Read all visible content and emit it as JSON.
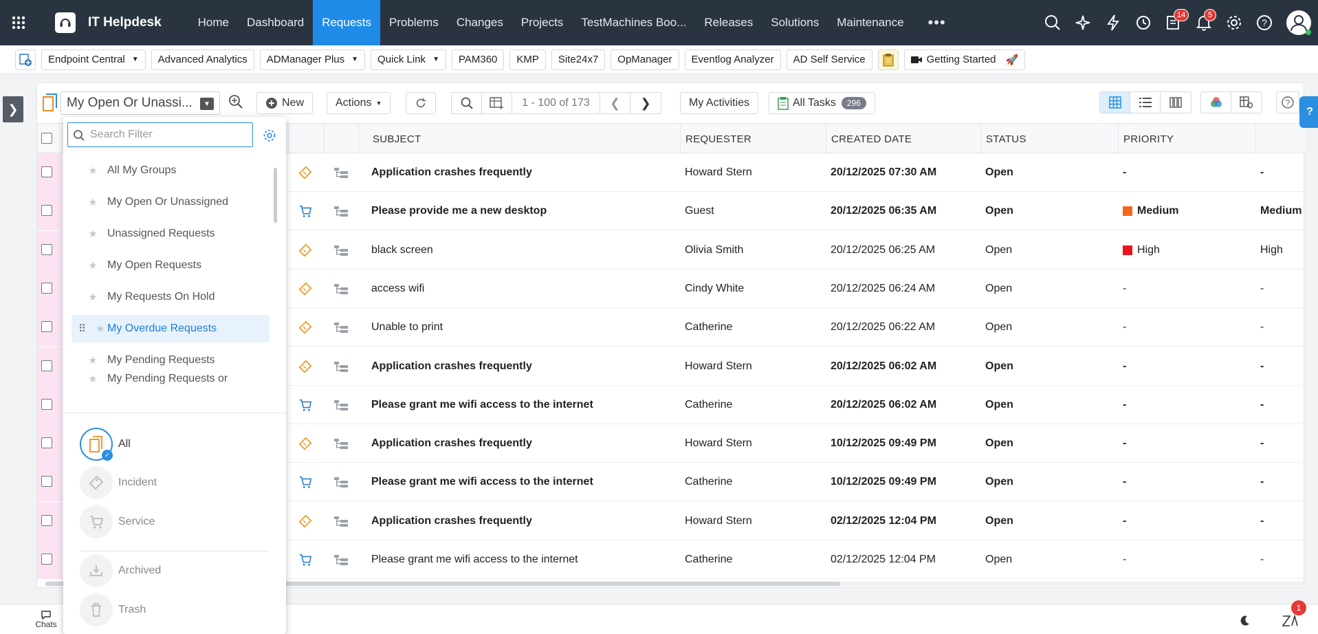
{
  "app": {
    "name": "IT Helpdesk"
  },
  "nav": {
    "tabs": [
      "Home",
      "Dashboard",
      "Requests",
      "Problems",
      "Changes",
      "Projects",
      "TestMachines Boo...",
      "Releases",
      "Solutions",
      "Maintenance"
    ],
    "active": "Requests",
    "more": "•••",
    "badges": {
      "tasks": "14",
      "notifications": "5"
    }
  },
  "quicklinks": {
    "items": [
      {
        "label": "Endpoint Central",
        "dropdown": true
      },
      {
        "label": "Advanced Analytics",
        "dropdown": false
      },
      {
        "label": "ADManager Plus",
        "dropdown": true
      },
      {
        "label": "Quick Link",
        "dropdown": true
      },
      {
        "label": "PAM360",
        "dropdown": false
      },
      {
        "label": "KMP",
        "dropdown": false
      },
      {
        "label": "Site24x7",
        "dropdown": false
      },
      {
        "label": "OpManager",
        "dropdown": false
      },
      {
        "label": "Eventlog Analyzer",
        "dropdown": false
      },
      {
        "label": "AD Self Service",
        "dropdown": false
      }
    ],
    "getting_started": "Getting Started"
  },
  "toolbar": {
    "view": "My Open Or Unassi...",
    "new": "New",
    "actions": "Actions",
    "paging": "1 - 100 of 173",
    "my_activities": "My Activities",
    "all_tasks": "All Tasks",
    "all_tasks_count": "296"
  },
  "table": {
    "columns": [
      "SUBJECT",
      "REQUESTER",
      "CREATED DATE",
      "STATUS",
      "PRIORITY"
    ],
    "rows": [
      {
        "type": "incident",
        "subject": "Application crashes frequently",
        "requester": "Howard Stern",
        "created": "20/12/2025 07:30 AM",
        "status": "Open",
        "priority": "-",
        "priority_color": "",
        "bold": true,
        "marked": true
      },
      {
        "type": "service",
        "subject": "Please provide me a new desktop",
        "requester": "Guest",
        "created": "20/12/2025 06:35 AM",
        "status": "Open",
        "priority": "Medium",
        "priority_color": "#f26b1d",
        "bold": true,
        "marked": true
      },
      {
        "type": "incident",
        "subject": "black screen",
        "requester": "Olivia Smith",
        "created": "20/12/2025 06:25 AM",
        "status": "Open",
        "priority": "High",
        "priority_color": "#e8141b",
        "bold": false,
        "marked": true
      },
      {
        "type": "incident",
        "subject": "access wifi",
        "requester": "Cindy White",
        "created": "20/12/2025 06:24 AM",
        "status": "Open",
        "priority": "-",
        "priority_color": "",
        "bold": false,
        "marked": true
      },
      {
        "type": "incident",
        "subject": "Unable to print",
        "requester": "Catherine",
        "created": "20/12/2025 06:22 AM",
        "status": "Open",
        "priority": "-",
        "priority_color": "",
        "bold": false,
        "marked": true
      },
      {
        "type": "incident",
        "subject": "Application crashes frequently",
        "requester": "Howard Stern",
        "created": "20/12/2025 06:02 AM",
        "status": "Open",
        "priority": "-",
        "priority_color": "",
        "bold": true,
        "marked": true
      },
      {
        "type": "service",
        "subject": "Please grant me wifi access to the internet",
        "requester": "Catherine",
        "created": "20/12/2025 06:02 AM",
        "status": "Open",
        "priority": "-",
        "priority_color": "",
        "bold": true,
        "marked": true
      },
      {
        "type": "incident",
        "subject": "Application crashes frequently",
        "requester": "Howard Stern",
        "created": "10/12/2025 09:49 PM",
        "status": "Open",
        "priority": "-",
        "priority_color": "",
        "bold": true,
        "marked": true
      },
      {
        "type": "service",
        "subject": "Please grant me wifi access to the internet",
        "requester": "Catherine",
        "created": "10/12/2025 09:49 PM",
        "status": "Open",
        "priority": "-",
        "priority_color": "",
        "bold": true,
        "marked": true
      },
      {
        "type": "incident",
        "subject": "Application crashes frequently",
        "requester": "Howard Stern",
        "created": "02/12/2025 12:04 PM",
        "status": "Open",
        "priority": "-",
        "priority_color": "",
        "bold": true,
        "marked": true
      },
      {
        "type": "service",
        "subject": "Please grant me wifi access to the internet",
        "requester": "Catherine",
        "created": "02/12/2025 12:04 PM",
        "status": "Open",
        "priority": "-",
        "priority_color": "",
        "bold": false,
        "marked": true
      }
    ]
  },
  "filter": {
    "search_placeholder": "Search Filter",
    "items": [
      "All My Groups",
      "My Open Or Unassigned",
      "Unassigned Requests",
      "My Open Requests",
      "My Requests On Hold",
      "My Overdue Requests",
      "My Pending Requests",
      "My Pending Requests or"
    ],
    "highlighted": "My Overdue Requests",
    "types": [
      "All",
      "Incident",
      "Service"
    ],
    "other": [
      "Archived",
      "Trash"
    ]
  },
  "bottom": {
    "chats": "Chats",
    "notif_badge": "1"
  },
  "colors": {
    "nav_bg": "#2a3441",
    "accent": "#1f8be8",
    "row_marker": "#fbe3f4"
  }
}
